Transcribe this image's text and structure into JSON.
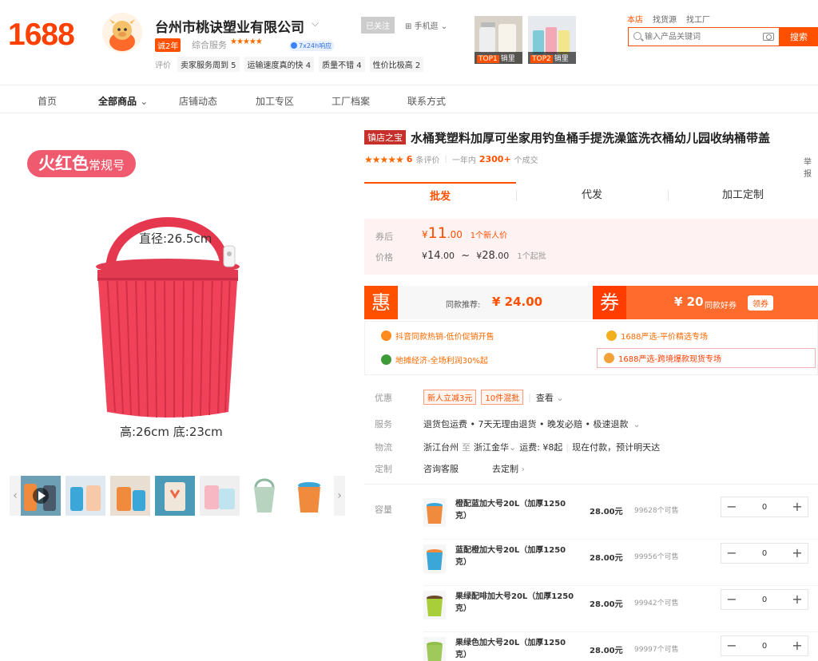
{
  "header": {
    "logo": "1688",
    "shop_name": "台州市桃诀塑业有限公司",
    "years_badge": "诚2年",
    "service_label": "综合服务",
    "service_stars": "★★★★★",
    "response_badge": "7x24h响应",
    "rating_label": "评价",
    "ratings": [
      "卖家服务周到 5",
      "运输速度真的快 4",
      "质量不错 4",
      "性价比极高 2"
    ],
    "follow_label": "已关注",
    "mobile_label": "手机逛",
    "top_products": [
      {
        "rank": "TOP1",
        "label": "销里"
      },
      {
        "rank": "TOP2",
        "label": "销里"
      }
    ],
    "search_tabs": [
      "本店",
      "找货源",
      "找工厂"
    ],
    "search_placeholder": "输入产品关键词",
    "search_button": "搜索"
  },
  "nav": {
    "items": [
      "首页",
      "全部商品",
      "店铺动态",
      "加工专区",
      "工厂档案",
      "联系方式"
    ]
  },
  "image": {
    "color_tag_main": "火红色",
    "color_tag_sub": "常规号",
    "diameter_label": "直径:26.5cm",
    "height_label": "高:26cm 底:23cm",
    "colors": {
      "bucket": "#f0435a",
      "bucket_dark": "#d8334a",
      "tag": "#f05a6e"
    }
  },
  "product": {
    "title_badge": "镇店之宝",
    "title": "水桶凳塑料加厚可坐家用钓鱼桶手提洗澡篮洗衣桶幼儿园收纳桶带盖",
    "report_label": "举报",
    "stars": "★★★★★",
    "review_count": "6",
    "review_label": "条评价",
    "period_label": "一年内",
    "sales_count": "2300+",
    "sales_label": "个成交"
  },
  "tabs": [
    "批发",
    "代发",
    "加工定制"
  ],
  "price": {
    "coupon_label": "券后",
    "coupon_currency": "¥",
    "coupon_int": "11",
    "coupon_dec": ".00",
    "coupon_note": "1个新人价",
    "price_label": "价格",
    "low_int": "14",
    "low_dec": ".00",
    "high_int": "28",
    "high_dec": ".00",
    "range_sep": "~",
    "moq": "1个起批"
  },
  "promo": {
    "hui_char": "惠",
    "same_label": "同款推荐:",
    "same_value": "¥ 24.00",
    "quan_char": "券",
    "coupon_value": "¥ 20",
    "coupon_text": "同款好券",
    "claim_button": "领券"
  },
  "links": [
    {
      "text": "抖音同款热销-低价促销开售",
      "icon": "sun-icon"
    },
    {
      "text": "1688严选-平价精选专场",
      "icon": "flower-icon"
    },
    {
      "text": "地摊经济-全场利润30%起",
      "icon": "leaf-icon"
    },
    {
      "text": "1688严选-跨境爆款现货专场",
      "icon": "fruit-icon"
    }
  ],
  "info": {
    "discount_label": "优惠",
    "discount_tags": [
      "新人立减3元",
      "10件混批"
    ],
    "discount_more": "查看",
    "service_label": "服务",
    "service_text": "退货包运费 • 7天无理由退货 • 晚发必赔 • 极速退款",
    "logistics_label": "物流",
    "logistics_from": "浙江台州",
    "logistics_to_word": "至",
    "logistics_to": "浙江金华",
    "shipping_fee": "运费: ¥8起",
    "delivery": "现在付款，预计明天达",
    "custom_label": "定制",
    "custom_consult": "咨询客服",
    "custom_go": "去定制"
  },
  "sku": {
    "label": "容量",
    "rows": [
      {
        "name": "橙配蓝加大号20L（加厚1250克）",
        "price": "28.00元",
        "stock": "99628个可售",
        "qty": "0",
        "color": "#f08a3c"
      },
      {
        "name": "蓝配橙加大号20L（加厚1250克）",
        "price": "28.00元",
        "stock": "99956个可售",
        "qty": "0",
        "color": "#3aa7d8"
      },
      {
        "name": "果绿配啡加大号20L（加厚1250克）",
        "price": "28.00元",
        "stock": "99942个可售",
        "qty": "0",
        "color": "#a8cf3a"
      },
      {
        "name": "果绿色加大号20L（加厚1250克）",
        "price": "28.00元",
        "stock": "99997个可售",
        "qty": "0",
        "color": "#9fc95b"
      }
    ]
  },
  "colors": {
    "brand": "#ff5000",
    "price_bg": "#fff2f2"
  }
}
